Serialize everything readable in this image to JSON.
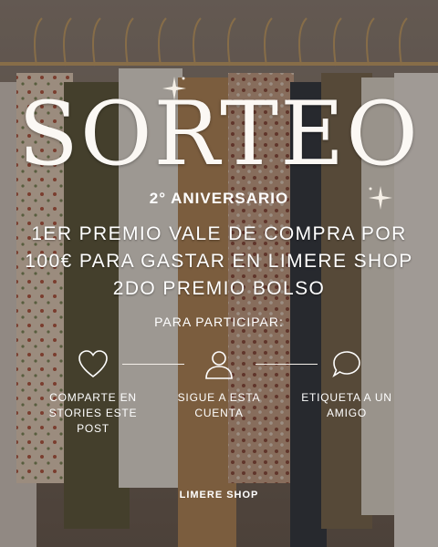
{
  "poster": {
    "title": "SORTEO",
    "subtitle": "2° ANIVERSARIO",
    "prizes": [
      "1ER PREMIO VALE DE COMPRA POR",
      "100€ PARA GASTAR EN LIMERE SHOP",
      "2DO PREMIO BOLSO"
    ],
    "participate_label": "PARA PARTICIPAR:",
    "steps": [
      {
        "icon": "heart-icon",
        "text": "COMPARTE EN\nSTORIES ESTE\nPOST"
      },
      {
        "icon": "user-icon",
        "text": "SIGUE A ESTA\nCUENTA"
      },
      {
        "icon": "speech-bubble-icon",
        "text": "ETIQUETA A UN\nAMIGO"
      }
    ],
    "brand": "LIMERE SHOP"
  },
  "colors": {
    "text": "#ffffff",
    "overlay": "#1e1612"
  }
}
